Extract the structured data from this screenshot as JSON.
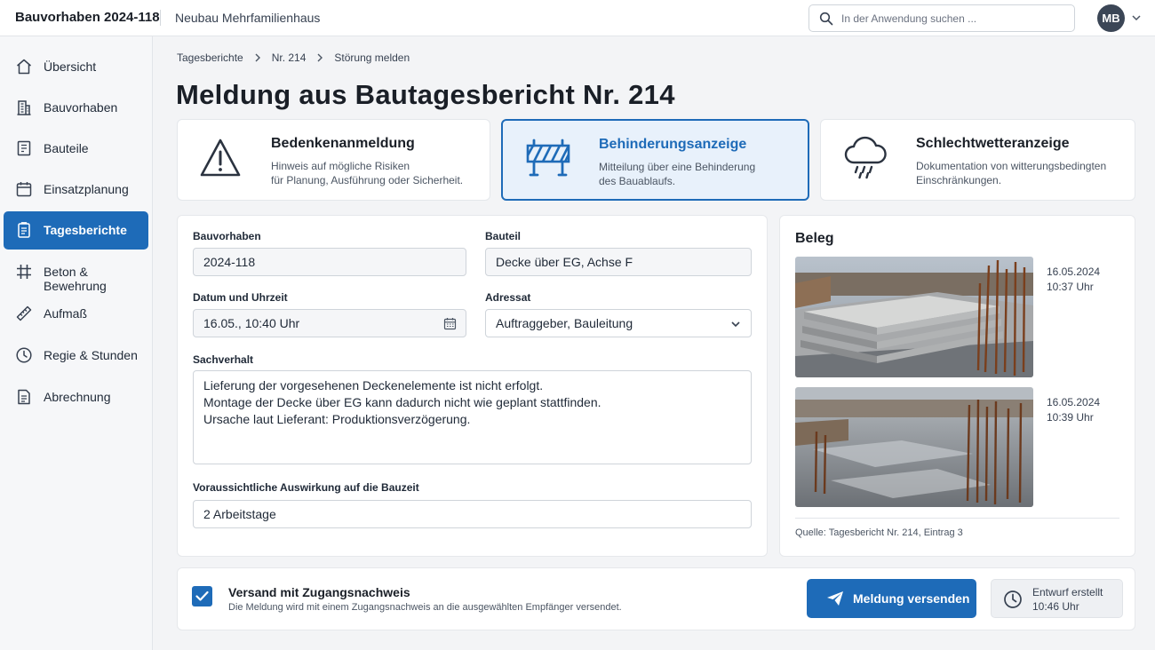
{
  "header": {
    "app_title": "Bauvorhaben 2024-118",
    "project_name": "Neubau Mehrfamilienhaus",
    "search_placeholder": "In der Anwendung suchen ...",
    "user_initials": "MB"
  },
  "sidebar": {
    "items": [
      {
        "label": "Übersicht",
        "icon": "home-icon"
      },
      {
        "label": "Bauvorhaben",
        "icon": "building-icon"
      },
      {
        "label": "Bauteile",
        "icon": "components-icon"
      },
      {
        "label": "Einsatzplanung",
        "icon": "calendar-icon"
      },
      {
        "label": "Tagesberichte",
        "icon": "report-icon",
        "active": true
      },
      {
        "label": "Beton & Bewehrung",
        "icon": "grid-icon"
      },
      {
        "label": "Aufmaß",
        "icon": "ruler-icon"
      },
      {
        "label": "Regie & Stunden",
        "icon": "clock-icon"
      },
      {
        "label": "Abrechnung",
        "icon": "invoice-icon"
      }
    ]
  },
  "breadcrumb": [
    "Tagesberichte",
    "Nr. 214",
    "Störung melden"
  ],
  "page_title": "Meldung aus Bautagesbericht Nr. 214",
  "report_types": [
    {
      "title": "Bedenkenanmeldung",
      "desc1": "Hinweis auf mögliche Risiken",
      "desc2": "für Planung, Ausführung oder Sicherheit.",
      "icon": "warning-icon"
    },
    {
      "title": "Behinderungsanzeige",
      "desc1": "Mitteilung über eine Behinderung",
      "desc2": "des Bauablaufs.",
      "icon": "barrier-icon",
      "selected": true
    },
    {
      "title": "Schlechtwetteranzeige",
      "desc1": "Dokumentation von witterungsbedingten",
      "desc2": "Einschränkungen.",
      "icon": "rain-cloud-icon"
    }
  ],
  "form": {
    "bauvorhaben_label": "Bauvorhaben",
    "bauvorhaben_value": "2024-118",
    "bauteil_label": "Bauteil",
    "bauteil_value": "Decke über EG, Achse F",
    "datum_label": "Datum und Uhrzeit",
    "datum_value": "16.05., 10:40 Uhr",
    "adressat_label": "Adressat",
    "adressat_value": "Auftraggeber, Bauleitung",
    "sachverhalt_label": "Sachverhalt",
    "sachverhalt_lines": [
      "Lieferung der vorgesehenen Deckenelemente ist nicht erfolgt.",
      "Montage der Decke über EG kann dadurch nicht wie geplant stattfinden.",
      "Ursache laut Lieferant: Produktionsverzögerung."
    ],
    "auswirkung_label": "Voraussichtliche Auswirkung auf die Bauzeit",
    "auswirkung_value": "2 Arbeitstage"
  },
  "beleg": {
    "title": "Beleg",
    "photos": [
      {
        "date": "16.05.2024",
        "time": "10:37 Uhr",
        "icon": "precast-slabs-photo"
      },
      {
        "date": "16.05.2024",
        "time": "10:39 Uhr",
        "icon": "empty-slab-photo"
      }
    ],
    "source": "Quelle: Tagesbericht Nr. 214, Eintrag 3"
  },
  "footer": {
    "checkbox_checked": true,
    "versand_title": "Versand mit Zugangsnachweis",
    "versand_desc": "Die Meldung wird mit einem Zugangsnachweis an die ausgewählten Empfänger versendet.",
    "send_label": "Meldung versenden",
    "draft_line1": "Entwurf erstellt",
    "draft_line2": "10:46 Uhr"
  },
  "colors": {
    "accent": "#1e6bb8",
    "selected_bg": "#e8f1fb",
    "background": "#f3f4f6"
  }
}
